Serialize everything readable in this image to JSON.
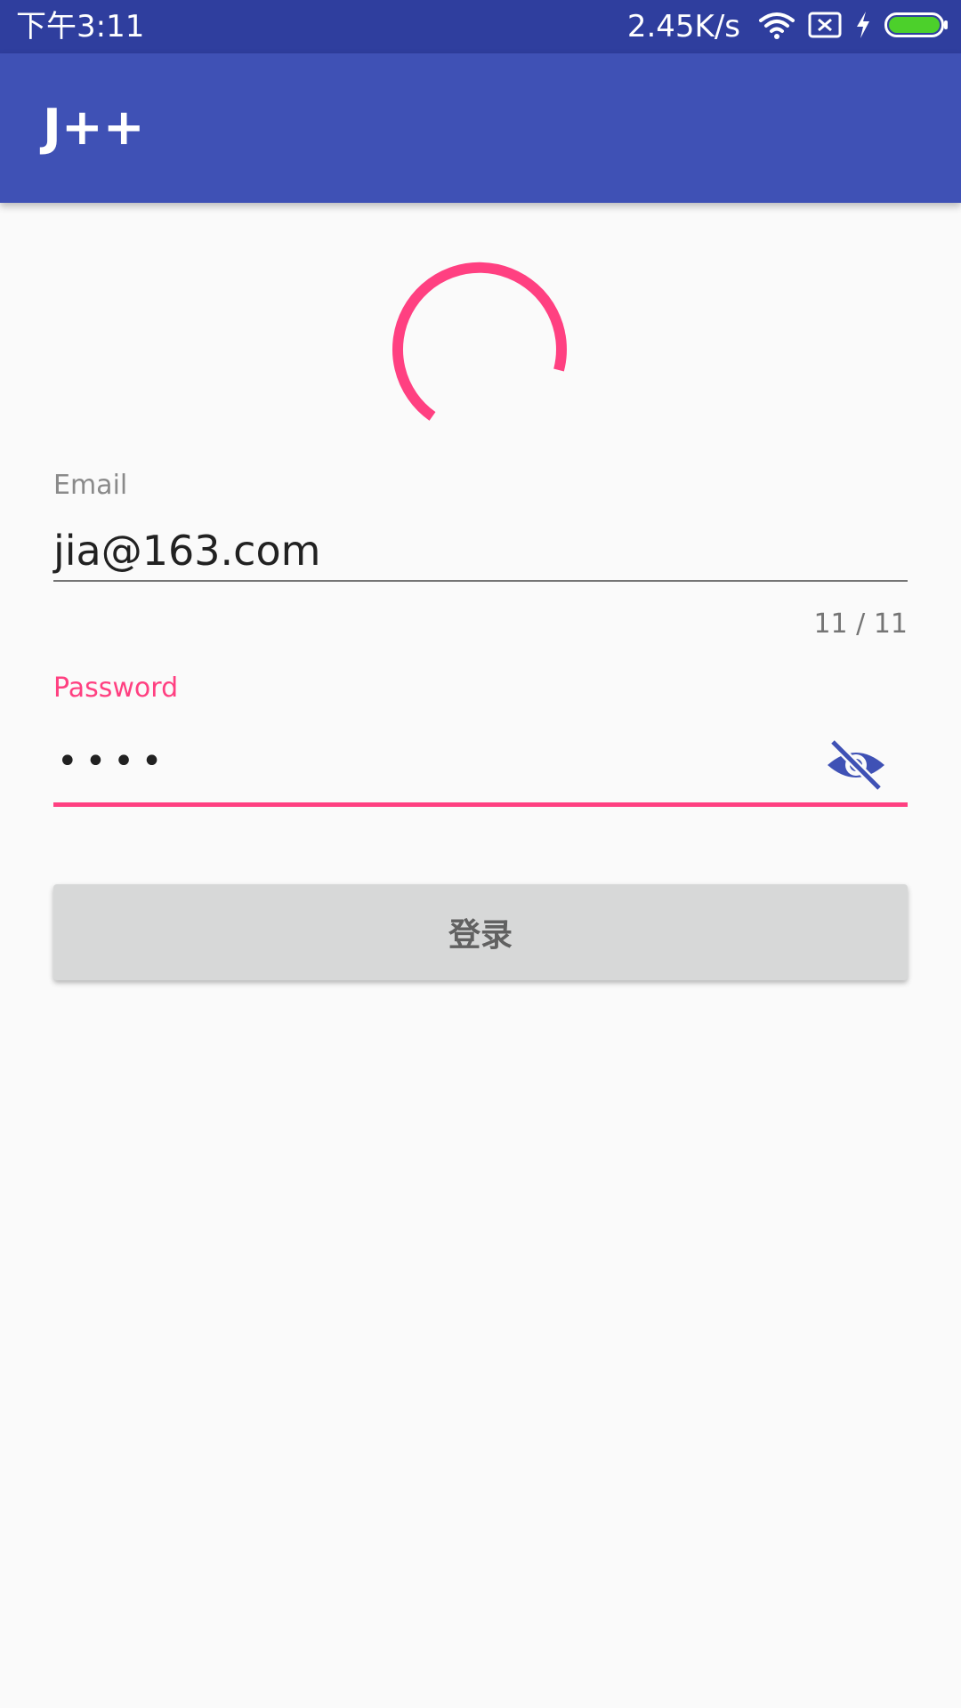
{
  "status_bar": {
    "time": "下午3:11",
    "net_speed": "2.45K/s",
    "icons": [
      "wifi-icon",
      "no-sim-icon",
      "charging-icon",
      "battery-icon"
    ],
    "battery_color": "#4cd02b"
  },
  "app_bar": {
    "title": "J++",
    "color": "#3f51b5"
  },
  "loading_spinner": {
    "color": "#ff4081"
  },
  "form": {
    "email": {
      "label": "Email",
      "value": "jia@163.com",
      "counter": "11 / 11"
    },
    "password": {
      "label": "Password",
      "value": "••••",
      "toggle_icon": "visibility-off-icon",
      "accent_color": "#ff4081"
    },
    "login_button": {
      "label": "登录"
    }
  }
}
